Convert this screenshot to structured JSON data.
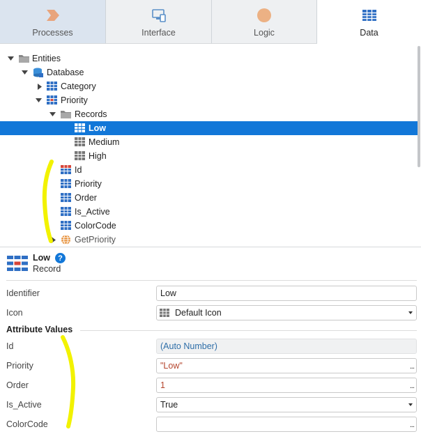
{
  "tabs": [
    {
      "label": "Processes",
      "icon": "processes-icon"
    },
    {
      "label": "Interface",
      "icon": "interface-icon"
    },
    {
      "label": "Logic",
      "icon": "logic-icon"
    },
    {
      "label": "Data",
      "icon": "data-icon"
    }
  ],
  "tree": {
    "entities": "Entities",
    "database": "Database",
    "category": "Category",
    "priority": "Priority",
    "records": "Records",
    "low": "Low",
    "medium": "Medium",
    "high": "High",
    "attr_id": "Id",
    "attr_priority": "Priority",
    "attr_order": "Order",
    "attr_is_active": "Is_Active",
    "attr_colorcode": "ColorCode",
    "action_getpriority": "GetPriority"
  },
  "properties": {
    "title": "Low",
    "subtitle": "Record",
    "help": "?",
    "identifier_label": "Identifier",
    "identifier_value": "Low",
    "icon_label": "Icon",
    "icon_value": "Default Icon",
    "section_title": "Attribute Values",
    "id_label": "Id",
    "id_value": "(Auto Number)",
    "priority_label": "Priority",
    "priority_value": "\"Low\"",
    "order_label": "Order",
    "order_value": "1",
    "is_active_label": "Is_Active",
    "is_active_value": "True",
    "colorcode_label": "ColorCode",
    "colorcode_value": "",
    "more": "..."
  },
  "colors": {
    "selection": "#1277d8",
    "annotation": "#f2f200"
  }
}
